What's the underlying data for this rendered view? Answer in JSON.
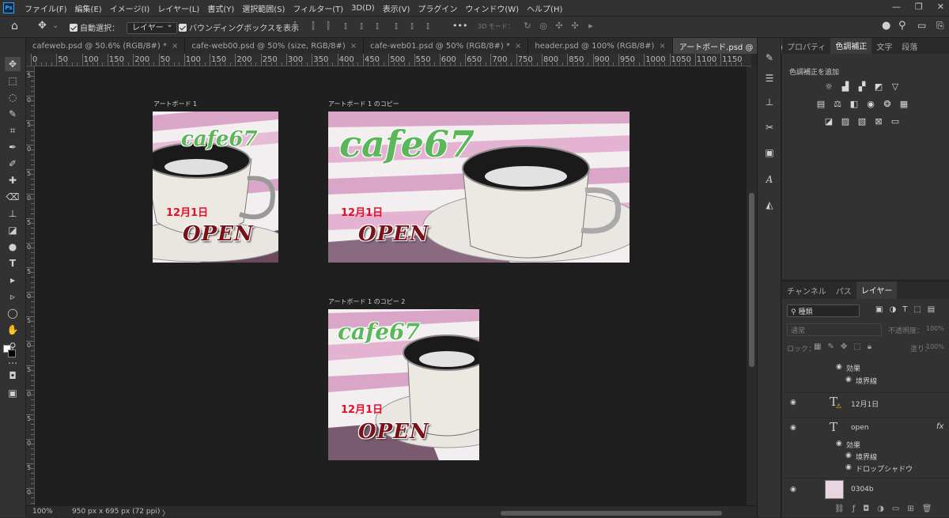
{
  "app": {
    "logo": "Ps",
    "accent": "#31a8ff"
  },
  "menu": [
    "ファイル(F)",
    "編集(E)",
    "イメージ(I)",
    "レイヤー(L)",
    "書式(Y)",
    "選択範囲(S)",
    "フィルター(T)",
    "3D(D)",
    "表示(V)",
    "プラグイン",
    "ウィンドウ(W)",
    "ヘルプ(H)"
  ],
  "window_controls": {
    "minimize": "—",
    "restore": "❐",
    "close": "✕"
  },
  "options": {
    "auto_select_label": "自動選択：",
    "auto_select_value": "レイヤー",
    "bbox_label": "バウンディングボックスを表示",
    "more": "•••",
    "mode3d": "3D モード："
  },
  "tabs": [
    {
      "label": "cafeweb.psd @ 50.6% (RGB/8#) *",
      "close": "×"
    },
    {
      "label": "cafe-web00.psd @ 50% (size, RGB/8#)",
      "close": "×"
    },
    {
      "label": "cafe-web01.psd @ 50% (RGB/8#) *",
      "close": "×"
    },
    {
      "label": "header.psd @ 100% (RGB/8#)",
      "close": "×"
    },
    {
      "label": "アートボード.psd @ 100% (RGB/8#)",
      "close": "×",
      "active": true
    }
  ],
  "ruler_h": [
    "0",
    "50",
    "100",
    "150",
    "200",
    "50",
    "100",
    "150",
    "200",
    "250",
    "300",
    "350",
    "400",
    "450",
    "500",
    "550",
    "600",
    "650",
    "700",
    "750",
    "800",
    "850",
    "900",
    "950",
    "1000",
    "1050",
    "1100",
    "1150"
  ],
  "ruler_v": [
    "5",
    "0",
    "5",
    "0",
    "5",
    "0",
    "5",
    "0",
    "5",
    "0",
    "5",
    "0",
    "5",
    "0",
    "5",
    "0",
    "5",
    "0"
  ],
  "artboards": [
    {
      "label": "アートボード 1",
      "cafe": "cafe67",
      "date": "12月1日",
      "open": "OPEN"
    },
    {
      "label": "アートボード 1 のコピー",
      "cafe": "cafe67",
      "date": "12月1日",
      "open": "OPEN"
    },
    {
      "label": "アートボード 1 のコピー 2",
      "cafe": "cafe67",
      "date": "12月1日",
      "open": "OPEN"
    }
  ],
  "status": {
    "zoom": "100%",
    "doc_size": "950 px x 695 px (72 ppi)",
    "arrow": "〉"
  },
  "panel_top": {
    "tabs": [
      "プロパティ",
      "色調補正",
      "文字",
      "段落"
    ],
    "active_tab": "色調補正",
    "title": "色調補正を追加"
  },
  "panel_layers": {
    "tabs": [
      "チャンネル",
      "パス",
      "レイヤー"
    ],
    "active_tab": "レイヤー",
    "filter": "種類",
    "blend_mode": "通常",
    "opacity_label": "不透明度：",
    "opacity_value": "100%",
    "lock_label": "ロック：",
    "fill_label": "塗り：",
    "fill_value": "100%",
    "layers": [
      {
        "name": "効果",
        "type": "effect-header"
      },
      {
        "name": "境界線",
        "type": "effect"
      },
      {
        "name": "12月1日",
        "type": "text-warning"
      },
      {
        "name": "open",
        "type": "text",
        "fx": "fx"
      },
      {
        "name": "効果",
        "type": "effect-header"
      },
      {
        "name": "境界線",
        "type": "effect"
      },
      {
        "name": "ドロップシャドウ",
        "type": "effect"
      },
      {
        "name": "0304b",
        "type": "image"
      }
    ]
  },
  "colors": {
    "cafe_green": "#5bb85a",
    "date_red": "#e3102a",
    "open_maroon": "#7a1018",
    "stripe_pink": "#d9a6c8"
  }
}
